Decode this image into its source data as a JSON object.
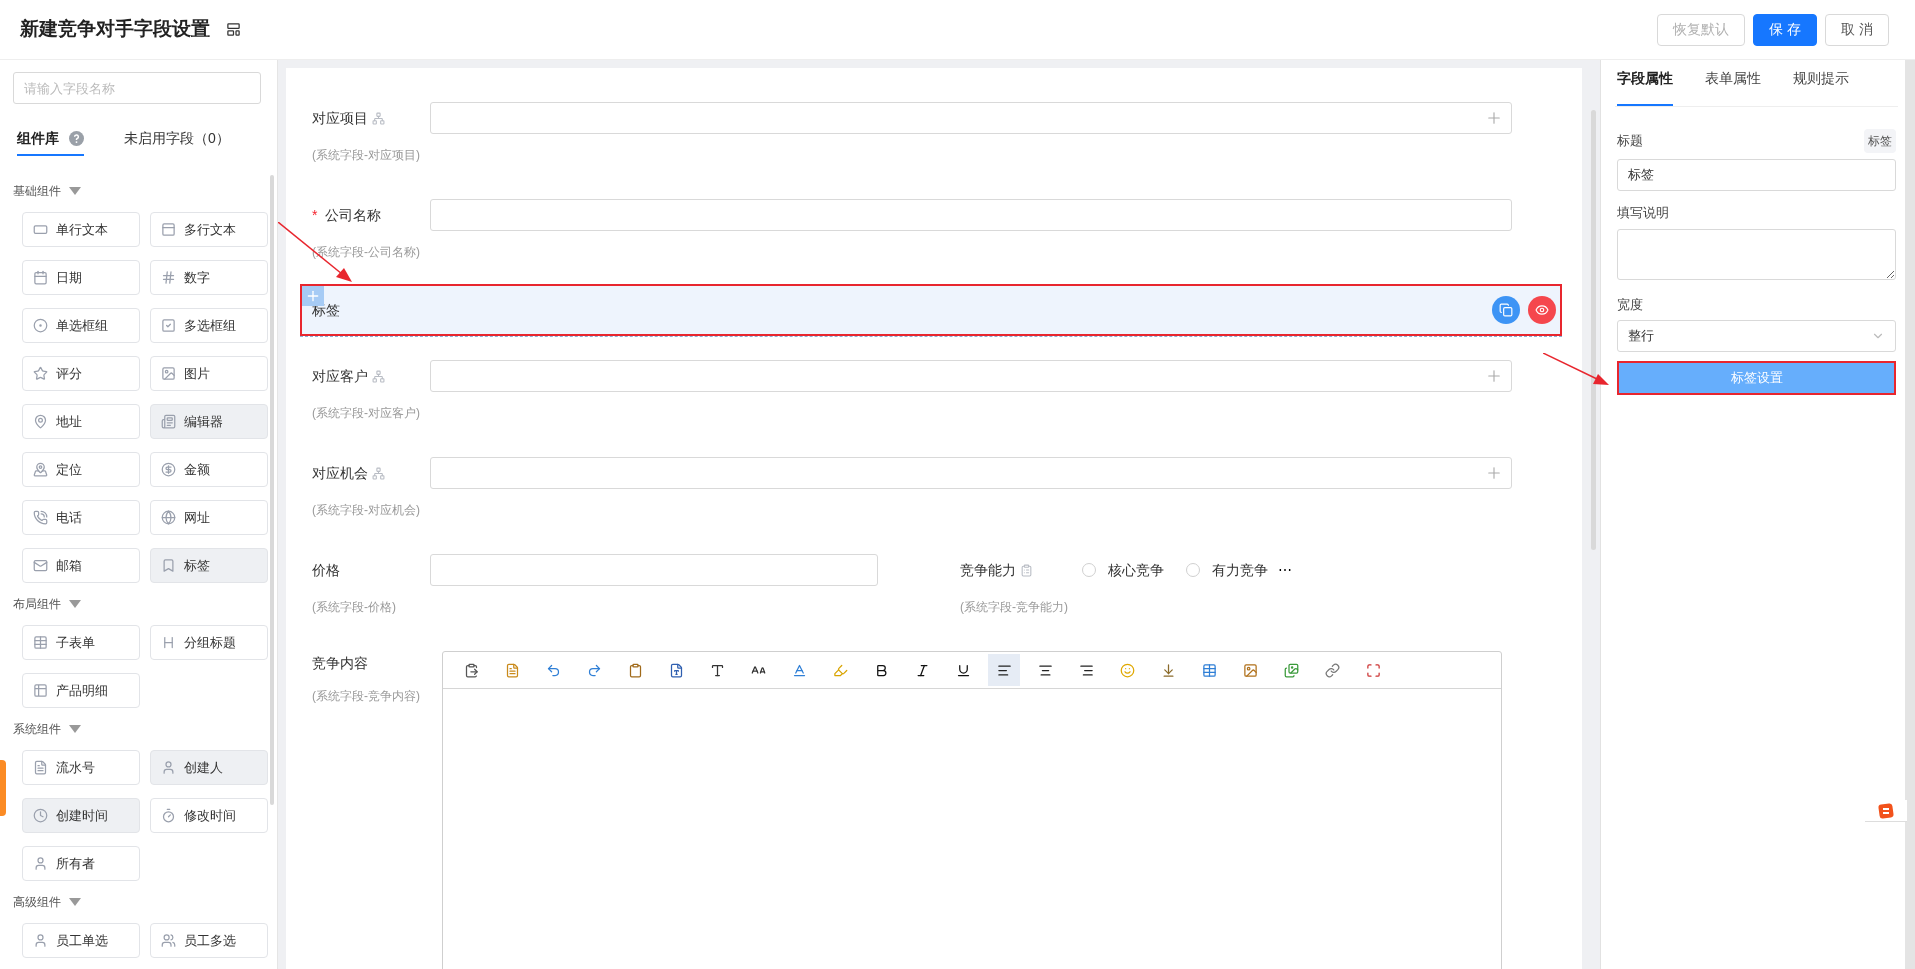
{
  "header": {
    "title": "新建竞争对手字段设置",
    "buttons": [
      {
        "label": "恢复默认",
        "kind": "reset"
      },
      {
        "label": "保 存",
        "kind": "primary"
      },
      {
        "label": "取 消",
        "kind": "default"
      }
    ]
  },
  "library": {
    "search_placeholder": "请输入字段名称",
    "tabs": [
      {
        "label": "组件库",
        "selected": true,
        "help": true
      },
      {
        "label": "未启用字段（0）",
        "selected": false,
        "help": false
      }
    ],
    "groups": [
      {
        "title": "基础组件",
        "items": [
          {
            "label": "单行文本",
            "kind": "single-text",
            "used": false
          },
          {
            "label": "多行文本",
            "kind": "multi-text",
            "used": false
          },
          {
            "label": "日期",
            "kind": "date",
            "used": false
          },
          {
            "label": "数字",
            "kind": "number",
            "used": false
          },
          {
            "label": "单选框组",
            "kind": "radio",
            "used": false
          },
          {
            "label": "多选框组",
            "kind": "checkbox",
            "used": false
          },
          {
            "label": "评分",
            "kind": "rating",
            "used": false
          },
          {
            "label": "图片",
            "kind": "image",
            "used": false
          },
          {
            "label": "地址",
            "kind": "address",
            "used": false
          },
          {
            "label": "编辑器",
            "kind": "editor",
            "used": true
          },
          {
            "label": "定位",
            "kind": "location",
            "used": false
          },
          {
            "label": "金额",
            "kind": "amount",
            "used": false
          },
          {
            "label": "电话",
            "kind": "phone",
            "used": false
          },
          {
            "label": "网址",
            "kind": "url",
            "used": false
          },
          {
            "label": "邮箱",
            "kind": "email",
            "used": false
          },
          {
            "label": "标签",
            "kind": "tag",
            "used": true
          }
        ]
      },
      {
        "title": "布局组件",
        "items": [
          {
            "label": "子表单",
            "kind": "subform",
            "used": false
          },
          {
            "label": "分组标题",
            "kind": "group-title",
            "used": false
          },
          {
            "label": "产品明细",
            "kind": "product",
            "used": false
          }
        ]
      },
      {
        "title": "系统组件",
        "items": [
          {
            "label": "流水号",
            "kind": "serial",
            "used": false
          },
          {
            "label": "创建人",
            "kind": "creator",
            "used": true
          },
          {
            "label": "创建时间",
            "kind": "created-time",
            "used": true
          },
          {
            "label": "修改时间",
            "kind": "modified-time",
            "used": false
          },
          {
            "label": "所有者",
            "kind": "owner",
            "used": false
          }
        ]
      },
      {
        "title": "高级组件",
        "items": [
          {
            "label": "员工单选",
            "kind": "employee-single",
            "used": false
          },
          {
            "label": "员工多选",
            "kind": "employee-multi",
            "used": false
          }
        ]
      }
    ]
  },
  "form": {
    "required_mark": "*",
    "rows": [
      {
        "fields": [
          {
            "kind": "lookup",
            "label": "对应项目",
            "required": false,
            "helper": "(系统字段-对应项目)"
          }
        ]
      },
      {
        "fields": [
          {
            "kind": "text",
            "label": "公司名称",
            "required": true,
            "helper": "(系统字段-公司名称)"
          }
        ]
      },
      {
        "fields": [
          {
            "kind": "selected-block",
            "label": "标签",
            "required": false
          }
        ]
      },
      {
        "fields": [
          {
            "kind": "lookup",
            "label": "对应客户",
            "required": false,
            "helper": "(系统字段-对应客户)"
          }
        ]
      },
      {
        "fields": [
          {
            "kind": "lookup",
            "label": "对应机会",
            "required": false,
            "helper": "(系统字段-对应机会)"
          }
        ]
      },
      {
        "fields": [
          {
            "kind": "short-text",
            "label": "价格",
            "required": false,
            "helper": "(系统字段-价格)"
          },
          {
            "kind": "radio",
            "label": "竞争能力",
            "required": false,
            "helper": "(系统字段-竞争能力)",
            "options": [
              {
                "label": "核心竞争",
                "selected": false
              },
              {
                "label": "有力竞争",
                "selected": false
              }
            ],
            "more": "⋯"
          }
        ]
      },
      {
        "fields": [
          {
            "kind": "editor",
            "label": "竞争内容",
            "helper": "(系统字段-竞争内容)",
            "toolbar": [
              {
                "kind": "paste-text",
                "selected": false
              },
              {
                "kind": "paste-doc",
                "selected": false
              },
              {
                "kind": "undo",
                "selected": false
              },
              {
                "kind": "redo",
                "selected": false
              },
              {
                "kind": "paste",
                "selected": false
              },
              {
                "kind": "paste-word",
                "selected": false
              },
              {
                "kind": "font-family",
                "selected": false
              },
              {
                "kind": "font-size",
                "selected": false
              },
              {
                "kind": "font-color",
                "selected": false
              },
              {
                "kind": "highlight",
                "selected": false
              },
              {
                "kind": "bold",
                "selected": false
              },
              {
                "kind": "italic",
                "selected": false
              },
              {
                "kind": "underline",
                "selected": false
              },
              {
                "kind": "align-left",
                "selected": true
              },
              {
                "kind": "align-center",
                "selected": false
              },
              {
                "kind": "align-right",
                "selected": false
              },
              {
                "kind": "emoji",
                "selected": false
              },
              {
                "kind": "rule",
                "selected": false
              },
              {
                "kind": "table",
                "selected": false
              },
              {
                "kind": "image",
                "selected": false
              },
              {
                "kind": "images",
                "selected": false
              },
              {
                "kind": "link",
                "selected": false
              },
              {
                "kind": "fullscreen",
                "selected": false
              }
            ]
          }
        ]
      }
    ]
  },
  "properties": {
    "tabs": [
      {
        "label": "字段属性",
        "selected": true
      },
      {
        "label": "表单属性",
        "selected": false
      },
      {
        "label": "规则提示",
        "selected": false
      }
    ],
    "title_label": "标题",
    "title_tag": "标签",
    "title_value": "标签",
    "description_label": "填写说明",
    "width_label": "宽度",
    "width_value": "整行",
    "settings_button": "标签设置"
  }
}
